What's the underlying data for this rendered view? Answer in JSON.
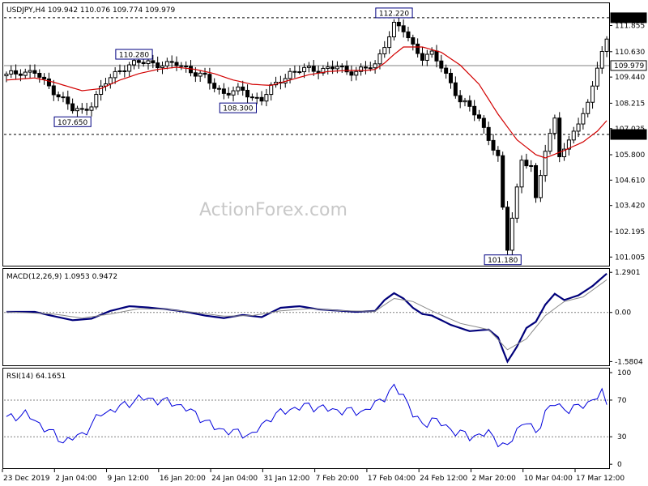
{
  "chart_data": [
    {
      "type": "candlestick",
      "title": "USDJPY,H4  109.942 110.076 109.774 109.979",
      "current_price": 109.979,
      "ylim": [
        100.6,
        112.9
      ],
      "y_ticks": [
        101.005,
        102.195,
        103.42,
        104.61,
        105.8,
        107.025,
        108.215,
        109.44,
        110.63,
        111.855
      ],
      "level_lines": [
        {
          "value": 112.22,
          "label": "112.220",
          "style": "dashed"
        },
        {
          "value": 106.75,
          "label": "106.750",
          "style": "dashed"
        },
        {
          "value": 109.979,
          "label": "109.979",
          "style": "solid"
        }
      ],
      "annotations": [
        {
          "text": "112.220",
          "x_index": 82,
          "value": 112.22
        },
        {
          "text": "110.280",
          "x_index": 27,
          "value": 110.28
        },
        {
          "text": "108.300",
          "x_index": 49,
          "value": 108.3
        },
        {
          "text": "107.650",
          "x_index": 14,
          "value": 107.65
        },
        {
          "text": "101.180",
          "x_index": 105,
          "value": 101.18
        }
      ],
      "series_points": [
        [
          0,
          109.5
        ],
        [
          3,
          109.7
        ],
        [
          6,
          109.65
        ],
        [
          8,
          109.2
        ],
        [
          10,
          108.8
        ],
        [
          12,
          108.4
        ],
        [
          14,
          107.9
        ],
        [
          16,
          107.85
        ],
        [
          18,
          108.2
        ],
        [
          20,
          108.9
        ],
        [
          22,
          109.4
        ],
        [
          24,
          109.8
        ],
        [
          26,
          110.0
        ],
        [
          28,
          110.1
        ],
        [
          30,
          110.15
        ],
        [
          32,
          110.05
        ],
        [
          34,
          110.0
        ],
        [
          36,
          110.05
        ],
        [
          38,
          109.9
        ],
        [
          40,
          109.6
        ],
        [
          42,
          109.4
        ],
        [
          44,
          109.0
        ],
        [
          46,
          108.7
        ],
        [
          48,
          108.75
        ],
        [
          50,
          108.8
        ],
        [
          52,
          108.5
        ],
        [
          54,
          108.4
        ],
        [
          56,
          108.9
        ],
        [
          58,
          109.3
        ],
        [
          60,
          109.65
        ],
        [
          62,
          109.75
        ],
        [
          64,
          109.8
        ],
        [
          66,
          109.8
        ],
        [
          68,
          109.85
        ],
        [
          70,
          109.9
        ],
        [
          72,
          109.7
        ],
        [
          74,
          109.75
        ],
        [
          76,
          109.85
        ],
        [
          78,
          109.95
        ],
        [
          80,
          111.0
        ],
        [
          82,
          111.9
        ],
        [
          84,
          111.6
        ],
        [
          86,
          110.9
        ],
        [
          88,
          110.4
        ],
        [
          90,
          110.5
        ],
        [
          92,
          109.9
        ],
        [
          94,
          109.2
        ],
        [
          96,
          108.3
        ],
        [
          98,
          108.0
        ],
        [
          100,
          107.5
        ],
        [
          102,
          106.6
        ],
        [
          104,
          105.6
        ],
        [
          105,
          103.2
        ],
        [
          106,
          101.4
        ],
        [
          107,
          102.9
        ],
        [
          109,
          105.6
        ],
        [
          111,
          105.2
        ],
        [
          112,
          103.6
        ],
        [
          114,
          106.1
        ],
        [
          116,
          107.5
        ],
        [
          117,
          105.8
        ],
        [
          119,
          106.3
        ],
        [
          121,
          107.4
        ],
        [
          123,
          108.2
        ],
        [
          125,
          109.9
        ],
        [
          127,
          111.1
        ]
      ],
      "ma_points": [
        [
          0,
          109.3
        ],
        [
          6,
          109.4
        ],
        [
          10,
          109.2
        ],
        [
          16,
          108.8
        ],
        [
          20,
          108.9
        ],
        [
          24,
          109.3
        ],
        [
          28,
          109.6
        ],
        [
          32,
          109.8
        ],
        [
          36,
          109.9
        ],
        [
          40,
          109.8
        ],
        [
          44,
          109.6
        ],
        [
          48,
          109.3
        ],
        [
          52,
          109.1
        ],
        [
          56,
          109.05
        ],
        [
          60,
          109.3
        ],
        [
          64,
          109.55
        ],
        [
          68,
          109.7
        ],
        [
          72,
          109.75
        ],
        [
          76,
          109.75
        ],
        [
          78,
          109.8
        ],
        [
          80,
          110.1
        ],
        [
          82,
          110.5
        ],
        [
          84,
          110.85
        ],
        [
          88,
          110.85
        ],
        [
          92,
          110.6
        ],
        [
          96,
          110.0
        ],
        [
          100,
          109.1
        ],
        [
          104,
          107.7
        ],
        [
          108,
          106.5
        ],
        [
          112,
          105.8
        ],
        [
          114,
          105.65
        ],
        [
          118,
          106.0
        ],
        [
          122,
          106.4
        ],
        [
          125,
          106.9
        ],
        [
          127,
          107.4
        ]
      ],
      "x_labels": [
        "23 Dec 2019",
        "2 Jan 04:00",
        "9 Jan 12:00",
        "16 Jan 20:00",
        "24 Jan 04:00",
        "31 Jan 12:00",
        "7 Feb 20:00",
        "17 Feb 04:00",
        "24 Feb 12:00",
        "2 Mar 20:00",
        "10 Mar 04:00",
        "17 Mar 12:00"
      ]
    },
    {
      "type": "line",
      "title": "MACD(12,26,9) 1.0953 0.9472",
      "ylim": [
        -1.7,
        1.4
      ],
      "y_ticks": [
        1.2901,
        0.0,
        -1.5804
      ],
      "zero_line": 0.0,
      "series": [
        {
          "name": "MACD",
          "points": [
            [
              0,
              0.02
            ],
            [
              6,
              0.02
            ],
            [
              10,
              -0.12
            ],
            [
              14,
              -0.25
            ],
            [
              18,
              -0.2
            ],
            [
              22,
              0.05
            ],
            [
              26,
              0.2
            ],
            [
              30,
              0.16
            ],
            [
              34,
              0.1
            ],
            [
              38,
              0.02
            ],
            [
              42,
              -0.1
            ],
            [
              46,
              -0.18
            ],
            [
              50,
              -0.08
            ],
            [
              54,
              -0.15
            ],
            [
              58,
              0.15
            ],
            [
              62,
              0.2
            ],
            [
              66,
              0.1
            ],
            [
              70,
              0.06
            ],
            [
              74,
              0.02
            ],
            [
              78,
              0.05
            ],
            [
              80,
              0.4
            ],
            [
              82,
              0.62
            ],
            [
              84,
              0.45
            ],
            [
              86,
              0.15
            ],
            [
              88,
              -0.05
            ],
            [
              90,
              -0.1
            ],
            [
              94,
              -0.4
            ],
            [
              98,
              -0.6
            ],
            [
              102,
              -0.55
            ],
            [
              104,
              -0.8
            ],
            [
              105,
              -1.2
            ],
            [
              106,
              -1.58
            ],
            [
              108,
              -1.1
            ],
            [
              110,
              -0.5
            ],
            [
              112,
              -0.3
            ],
            [
              114,
              0.25
            ],
            [
              116,
              0.6
            ],
            [
              118,
              0.4
            ],
            [
              121,
              0.55
            ],
            [
              124,
              0.85
            ],
            [
              127,
              1.25
            ]
          ]
        },
        {
          "name": "Signal",
          "points": [
            [
              0,
              0.02
            ],
            [
              10,
              -0.05
            ],
            [
              16,
              -0.18
            ],
            [
              22,
              -0.05
            ],
            [
              28,
              0.12
            ],
            [
              34,
              0.1
            ],
            [
              40,
              0.0
            ],
            [
              46,
              -0.12
            ],
            [
              52,
              -0.1
            ],
            [
              58,
              0.05
            ],
            [
              64,
              0.12
            ],
            [
              72,
              0.05
            ],
            [
              78,
              0.04
            ],
            [
              82,
              0.45
            ],
            [
              86,
              0.35
            ],
            [
              90,
              0.05
            ],
            [
              96,
              -0.35
            ],
            [
              102,
              -0.55
            ],
            [
              106,
              -1.2
            ],
            [
              110,
              -0.85
            ],
            [
              114,
              -0.1
            ],
            [
              118,
              0.35
            ],
            [
              122,
              0.5
            ],
            [
              127,
              1.05
            ]
          ]
        }
      ]
    },
    {
      "type": "line",
      "title": "RSI(14) 64.1651",
      "ylim": [
        0,
        100
      ],
      "y_ticks": [
        100,
        70,
        30,
        0
      ],
      "reference_lines": [
        70,
        30
      ],
      "series": [
        {
          "name": "RSI",
          "points": [
            [
              0,
              50
            ],
            [
              4,
              55
            ],
            [
              8,
              40
            ],
            [
              12,
              25
            ],
            [
              16,
              32
            ],
            [
              20,
              55
            ],
            [
              24,
              62
            ],
            [
              28,
              72
            ],
            [
              32,
              70
            ],
            [
              36,
              66
            ],
            [
              40,
              55
            ],
            [
              44,
              40
            ],
            [
              48,
              35
            ],
            [
              52,
              32
            ],
            [
              56,
              52
            ],
            [
              60,
              60
            ],
            [
              64,
              64
            ],
            [
              68,
              60
            ],
            [
              72,
              58
            ],
            [
              76,
              58
            ],
            [
              80,
              74
            ],
            [
              82,
              83
            ],
            [
              84,
              76
            ],
            [
              86,
              55
            ],
            [
              88,
              42
            ],
            [
              90,
              50
            ],
            [
              94,
              38
            ],
            [
              98,
              30
            ],
            [
              102,
              34
            ],
            [
              104,
              25
            ],
            [
              106,
              18
            ],
            [
              108,
              38
            ],
            [
              110,
              48
            ],
            [
              112,
              32
            ],
            [
              114,
              58
            ],
            [
              116,
              66
            ],
            [
              118,
              60
            ],
            [
              121,
              62
            ],
            [
              124,
              70
            ],
            [
              126,
              78
            ],
            [
              127,
              64
            ]
          ]
        }
      ]
    }
  ],
  "watermark": "ActionForex.com"
}
